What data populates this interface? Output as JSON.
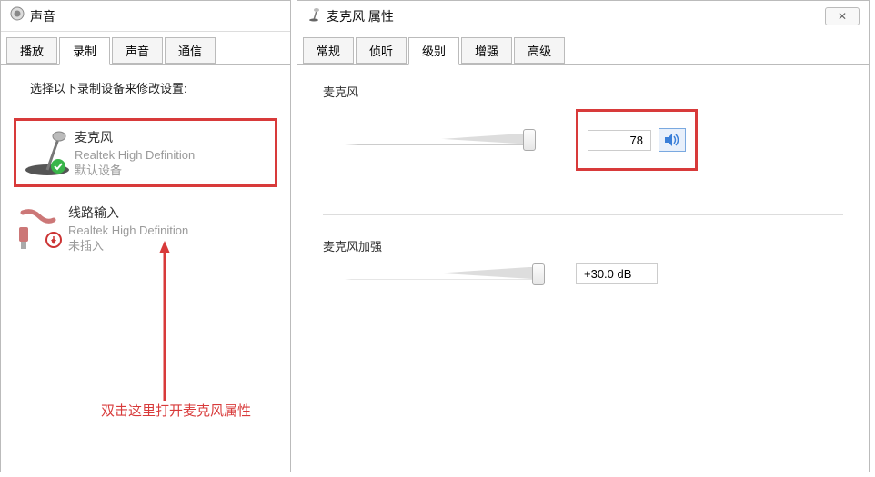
{
  "sound_window": {
    "title": "声音",
    "tabs": [
      "播放",
      "录制",
      "声音",
      "通信"
    ],
    "active_tab": 1,
    "instruction": "选择以下录制设备来修改设置:",
    "devices": [
      {
        "name": "麦克风",
        "subtitle": "Realtek High Definition",
        "status": "默认设备"
      },
      {
        "name": "线路输入",
        "subtitle": "Realtek High Definition",
        "status": "未插入"
      }
    ]
  },
  "mic_window": {
    "title": "麦克风 属性",
    "tabs": [
      "常规",
      "侦听",
      "级别",
      "增强",
      "高级"
    ],
    "active_tab": 2,
    "mic_label": "麦克风",
    "mic_value": "78",
    "boost_label": "麦克风加强",
    "boost_value": "+30.0 dB"
  },
  "annotation": "双击这里打开麦克风属性"
}
